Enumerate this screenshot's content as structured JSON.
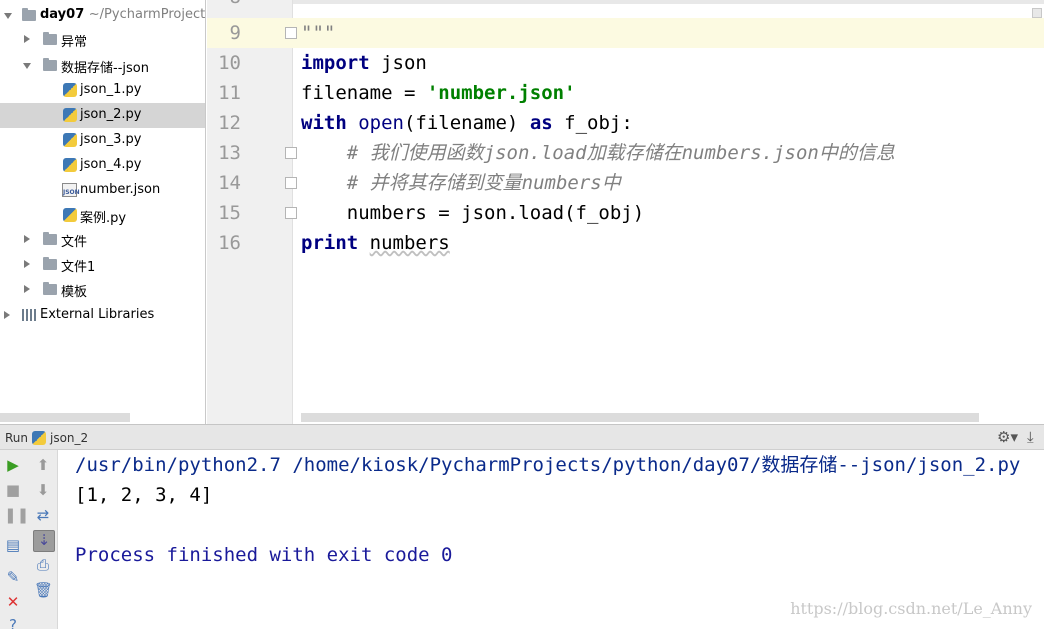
{
  "project": {
    "root": {
      "name": "day07",
      "path": "~/PycharmProjects"
    },
    "items": [
      {
        "label": "异常"
      },
      {
        "label": "数据存储--json"
      },
      {
        "label": "json_1.py"
      },
      {
        "label": "json_2.py"
      },
      {
        "label": "json_3.py"
      },
      {
        "label": "json_4.py"
      },
      {
        "label": "number.json"
      },
      {
        "label": "案例.py"
      },
      {
        "label": "文件"
      },
      {
        "label": "文件1"
      },
      {
        "label": "模板"
      },
      {
        "label": "External Libraries"
      }
    ],
    "json_icon_text": "JSON",
    "selected": "json_2.py",
    "icons": {
      "folder": "folder-icon",
      "python": "python-file-icon",
      "json": "json-file-icon",
      "libraries": "libraries-icon"
    }
  },
  "editor": {
    "top_partial_line_number": "8",
    "lines": [
      {
        "num": "9",
        "text": "\"\"\""
      },
      {
        "num": "10",
        "kw": "import",
        "rest": " json"
      },
      {
        "num": "11",
        "pre": "filename = ",
        "str": "'number.json'"
      },
      {
        "num": "12",
        "kw": "with",
        "sp": " ",
        "builtin": "open",
        "mid": "(filename) ",
        "kw2": "as",
        "rest": " f_obj:"
      },
      {
        "num": "13",
        "comment": "    # 我们使用函数json.load加载存储在numbers.json中的信息"
      },
      {
        "num": "14",
        "comment": "    # 并将其存储到变量numbers中"
      },
      {
        "num": "15",
        "text": "    numbers = json.load(f_obj)"
      },
      {
        "num": "16",
        "kw": "print",
        "sp": " ",
        "squig": "numbers"
      }
    ],
    "colors": {
      "keyword": "#000080",
      "string": "#008000",
      "comment": "#808080",
      "current_line": "#fcfae1"
    }
  },
  "run": {
    "title": "Run",
    "config": "json_2",
    "toolbar_icons": [
      "run-icon",
      "stop-icon",
      "pause-icon",
      "layout-icon",
      "pin-icon",
      "close-icon",
      "help-icon",
      "up-icon",
      "down-icon",
      "wrap-icon",
      "scroll-to-end-icon",
      "print-icon",
      "trash-icon",
      "gear-icon",
      "hide-icon"
    ],
    "console": {
      "command": "/usr/bin/python2.7 /home/kiosk/PycharmProjects/python/day07/数据存储--json/json_2.py",
      "output": "[1, 2, 3, 4]",
      "process": "Process finished with exit code 0"
    },
    "watermark": "https://blog.csdn.net/Le_Anny"
  }
}
